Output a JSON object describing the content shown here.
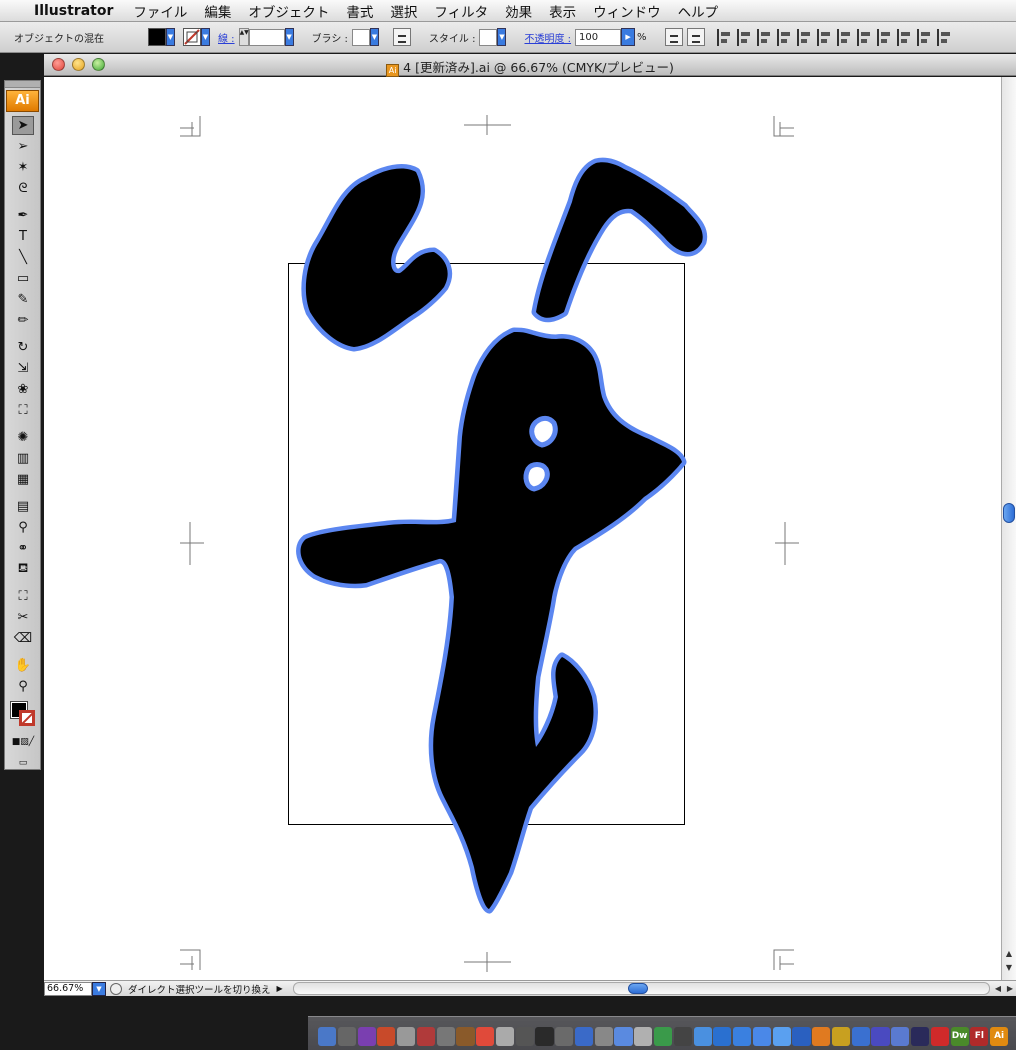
{
  "menubar": {
    "app_name": "Illustrator",
    "items": [
      "ファイル",
      "編集",
      "オブジェクト",
      "書式",
      "選択",
      "フィルタ",
      "効果",
      "表示",
      "ウィンドウ",
      "ヘルプ"
    ]
  },
  "controlbar": {
    "selection_label": "オブジェクトの混在",
    "stroke_label": "線 :",
    "brush_label": "ブラシ :",
    "style_label": "スタイル :",
    "opacity_label": "不透明度 :",
    "opacity_value": "100",
    "opacity_unit": "%"
  },
  "window": {
    "title": "4 [更新済み].ai @ 66.67% (CMYK/プレビュー)",
    "doc_icon_text": "Ai"
  },
  "toolbox": {
    "badge": "Ai",
    "tools": [
      {
        "name": "selection-tool",
        "glyph": "➤"
      },
      {
        "name": "direct-selection-tool",
        "glyph": "➢"
      },
      {
        "name": "magic-wand-tool",
        "glyph": "✶"
      },
      {
        "name": "lasso-tool",
        "glyph": "ᘓ"
      },
      {
        "name": "pen-tool",
        "glyph": "✒"
      },
      {
        "name": "type-tool",
        "glyph": "T"
      },
      {
        "name": "line-tool",
        "glyph": "╲"
      },
      {
        "name": "rectangle-tool",
        "glyph": "▭"
      },
      {
        "name": "paintbrush-tool",
        "glyph": "✎"
      },
      {
        "name": "pencil-tool",
        "glyph": "✏"
      },
      {
        "name": "rotate-tool",
        "glyph": "↻"
      },
      {
        "name": "scale-tool",
        "glyph": "⇲"
      },
      {
        "name": "warp-tool",
        "glyph": "❀"
      },
      {
        "name": "free-transform-tool",
        "glyph": "⛶"
      },
      {
        "name": "symbol-sprayer-tool",
        "glyph": "✺"
      },
      {
        "name": "column-graph-tool",
        "glyph": "▥"
      },
      {
        "name": "mesh-tool",
        "glyph": "▦"
      },
      {
        "name": "gradient-tool",
        "glyph": "▤"
      },
      {
        "name": "eyedropper-tool",
        "glyph": "⚲"
      },
      {
        "name": "blend-tool",
        "glyph": "⚭"
      },
      {
        "name": "live-paint-bucket-tool",
        "glyph": "⛾"
      },
      {
        "name": "live-paint-selection-tool",
        "glyph": "⛶"
      },
      {
        "name": "slice-tool",
        "glyph": "✂"
      },
      {
        "name": "eraser-tool",
        "glyph": "⌫"
      },
      {
        "name": "hand-tool",
        "glyph": "✋"
      },
      {
        "name": "zoom-tool",
        "glyph": "⚲"
      }
    ]
  },
  "statusbar": {
    "zoom": "66.67%",
    "status_text": "ダイレクト選択ツールを切り換え"
  },
  "colors": {
    "selection_outline": "#5b86f0",
    "artwork_fill": "#000000",
    "canvas_bg": "#ffffff",
    "accent_blue": "#3a7be0"
  },
  "dock": {
    "labeled_icons": [
      "Dw",
      "Fl",
      "Ai"
    ]
  }
}
